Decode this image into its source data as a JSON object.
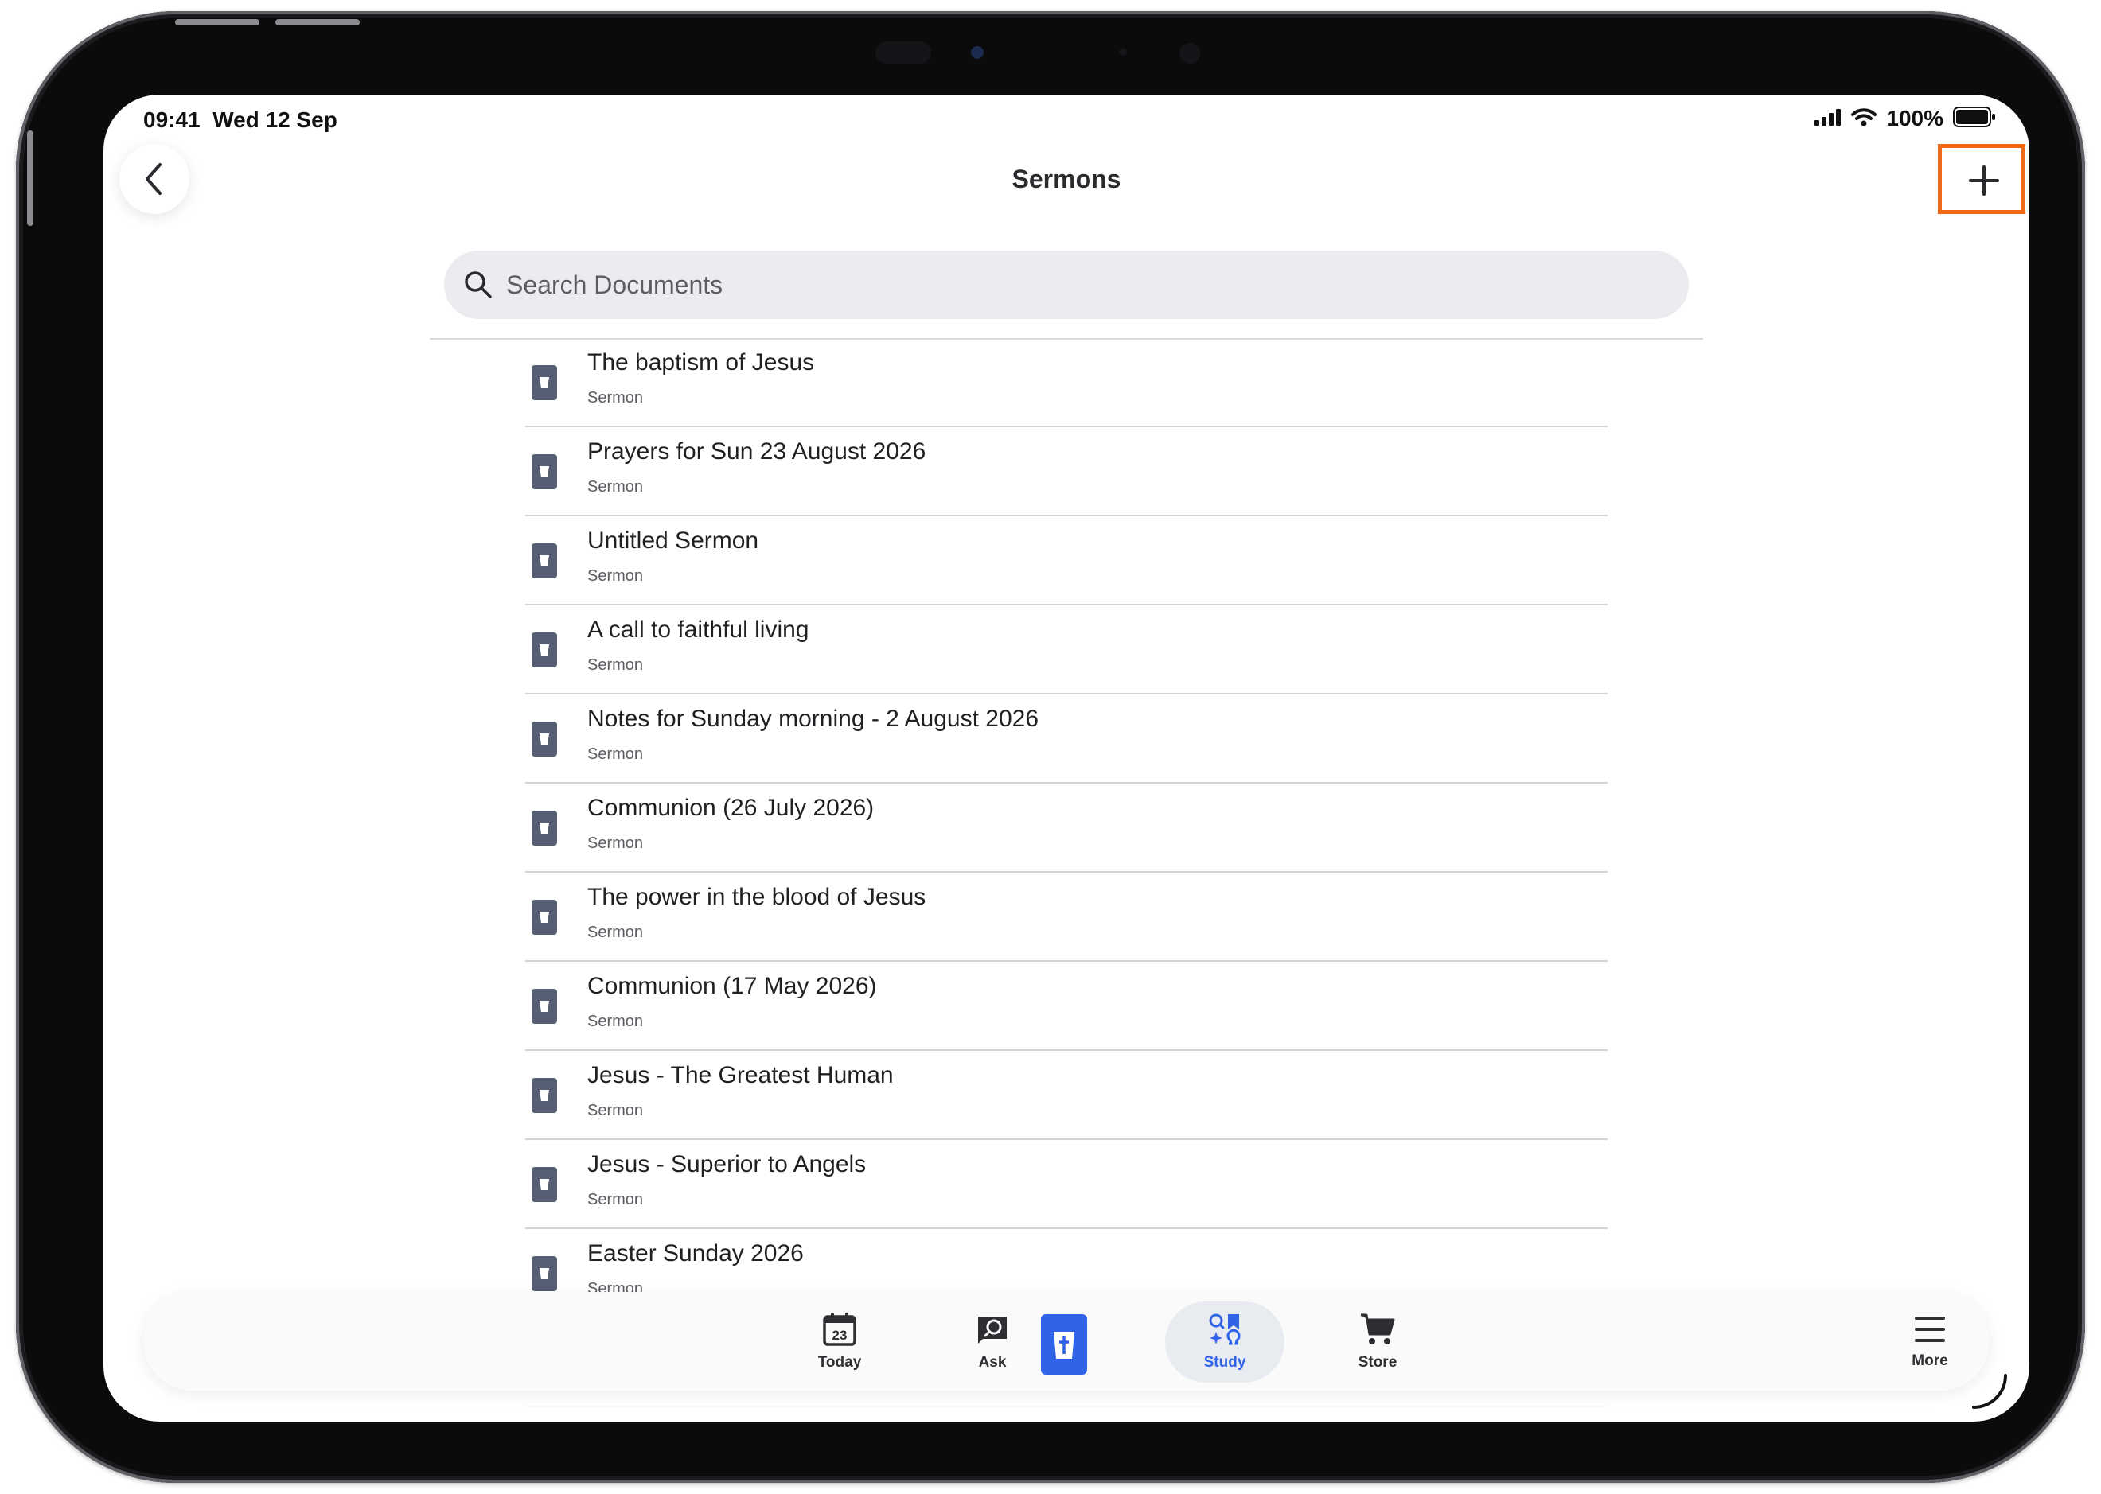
{
  "status_bar": {
    "time": "09:41",
    "date": "Wed 12 Sep",
    "battery": "100%"
  },
  "nav": {
    "title": "Sermons"
  },
  "search": {
    "placeholder": "Search Documents"
  },
  "documents": [
    {
      "title": "The baptism of Jesus",
      "type": "Sermon"
    },
    {
      "title": "Prayers for Sun 23 August 2026",
      "type": "Sermon"
    },
    {
      "title": "Untitled Sermon",
      "type": "Sermon"
    },
    {
      "title": "A call to faithful living",
      "type": "Sermon"
    },
    {
      "title": "Notes for Sunday morning - 2 August 2026",
      "type": "Sermon"
    },
    {
      "title": "Communion (26 July 2026)",
      "type": "Sermon"
    },
    {
      "title": "The power in the blood of Jesus",
      "type": "Sermon"
    },
    {
      "title": "Communion (17 May 2026)",
      "type": "Sermon"
    },
    {
      "title": "Jesus - The Greatest Human",
      "type": "Sermon"
    },
    {
      "title": "Jesus - Superior to Angels",
      "type": "Sermon"
    },
    {
      "title": "Easter Sunday 2026",
      "type": "Sermon"
    }
  ],
  "tabbar": {
    "today": {
      "label": "Today",
      "date_number": "23"
    },
    "ask": {
      "label": "Ask"
    },
    "study": {
      "label": "Study"
    },
    "store": {
      "label": "Store"
    },
    "more": {
      "label": "More"
    }
  },
  "colors": {
    "accent": "#2f63e8",
    "highlight": "#f06a15",
    "doc_icon": "#555e73"
  }
}
